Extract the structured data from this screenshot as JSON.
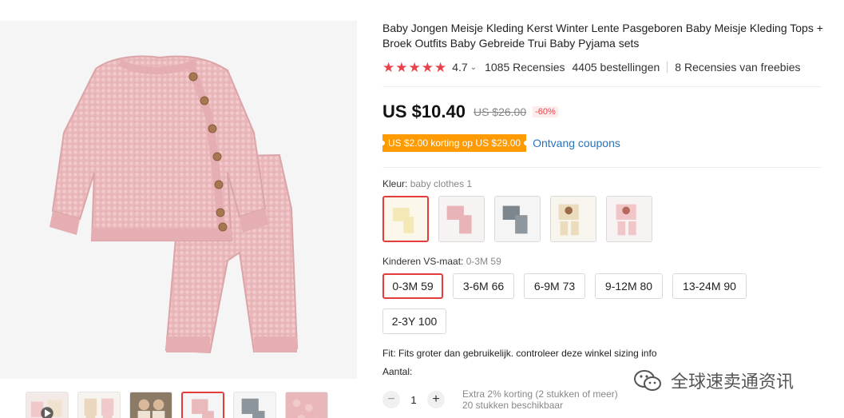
{
  "product": {
    "title": "Baby Jongen Meisje Kleding Kerst Winter Lente Pasgeboren Baby Meisje Kleding Tops + Broek Outfits Baby Gebreide Trui Baby Pyjama sets",
    "rating": "4.7",
    "reviews": "1085 Recensies",
    "orders": "4405 bestellingen",
    "freebie_reviews": "8 Recensies van freebies"
  },
  "price": {
    "current": "US $10.40",
    "original": "US $26.00",
    "discount": "-60%"
  },
  "coupon": {
    "badge": "US $2.00 korting op US $29.00",
    "link": "Ontvang coupons"
  },
  "color": {
    "label": "Kleur:",
    "selected": "baby clothes 1",
    "options": [
      "cream-knit-set",
      "pink-knit-set",
      "grey-knit-set",
      "beige-print-set",
      "pink-print-set"
    ]
  },
  "size": {
    "label": "Kinderen VS-maat:",
    "selected": "0-3M 59",
    "options": [
      "0-3M 59",
      "3-6M 66",
      "6-9M 73",
      "9-12M 80",
      "13-24M 90",
      "2-3Y 100"
    ]
  },
  "fit": "Fit: Fits groter dan gebruikelijk. controleer deze winkel sizing info",
  "quantity": {
    "label": "Aantal:",
    "value": "1",
    "minus": "−",
    "plus": "+",
    "discount_info": "Extra 2% korting (2 stukken of meer)",
    "available": "20 stukken beschikbaar"
  },
  "watermark": "全球速卖通资讯",
  "colors": {
    "accent_red": "#e43b3b",
    "coupon_orange": "#ff9a00",
    "link_blue": "#2a73b9",
    "sweater_pink": "#e8b4b6"
  }
}
